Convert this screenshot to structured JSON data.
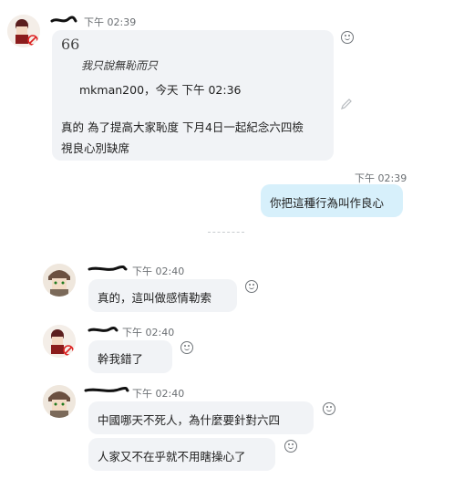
{
  "colors": {
    "incoming_bubble": "#f1f3f6",
    "outgoing_bubble": "#d7f0fb",
    "timestamp": "#6b6f73"
  },
  "messages": [
    {
      "sender_time": "下午 02:39",
      "quote": {
        "mark": "66",
        "text": "我只說無恥而只",
        "meta": "mkman200，今天 下午 02:36"
      },
      "line1": "真的 為了提高大家恥度 下月4日一起紀念六四檢",
      "line2": "視良心別缺席"
    },
    {
      "time": "下午 02:39",
      "text": "你把這種行為叫作良心"
    },
    {
      "time": "下午 02:40",
      "text": "真的，這叫做感情勒索"
    },
    {
      "time": "下午 02:40",
      "text": "幹我錯了"
    },
    {
      "time": "下午 02:40",
      "text1": "中國哪天不死人，為什麼要針對六四",
      "text2": "人家又不在乎就不用瞎操心了"
    }
  ],
  "icons": [
    "avatar-girl-icon",
    "avatar-boy-icon",
    "emoji-reaction-icon",
    "edit-pencil-icon"
  ]
}
